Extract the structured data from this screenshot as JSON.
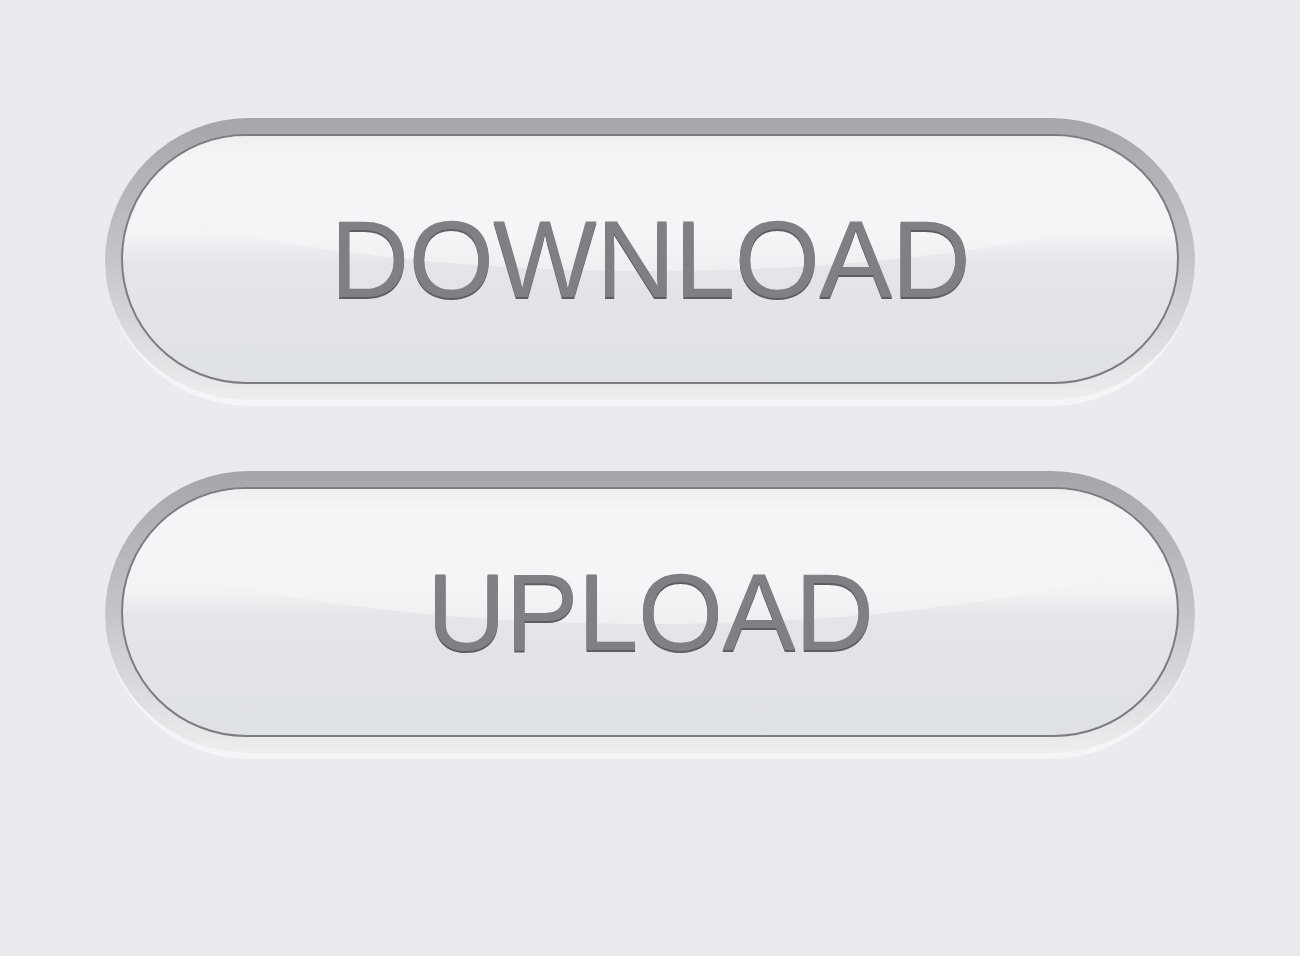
{
  "buttons": [
    {
      "label": "DOWNLOAD"
    },
    {
      "label": "UPLOAD"
    }
  ]
}
